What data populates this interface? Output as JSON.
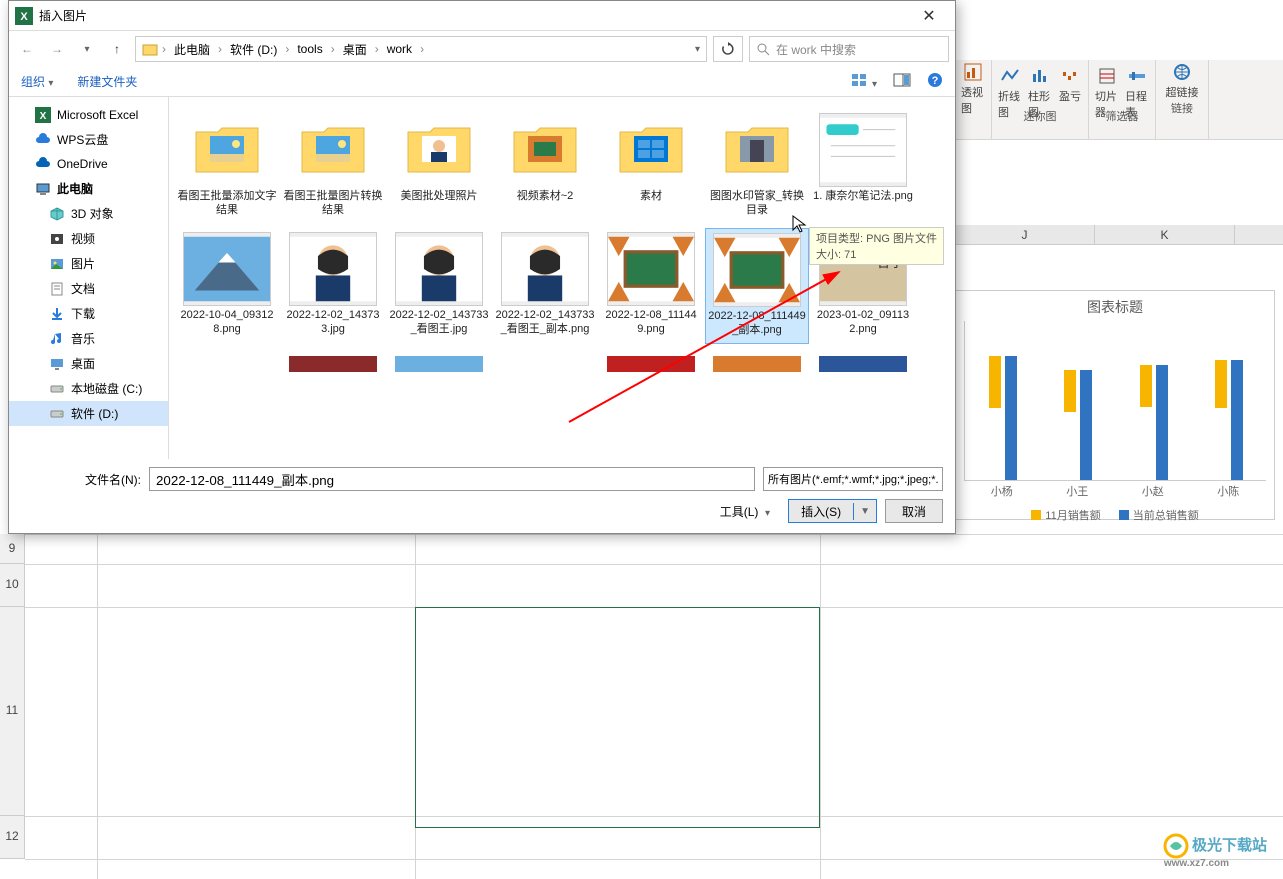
{
  "dialog": {
    "title": "插入图片",
    "close": "✕",
    "breadcrumbs": [
      "此电脑",
      "软件 (D:)",
      "tools",
      "桌面",
      "work"
    ],
    "search_placeholder": "在 work 中搜索",
    "organize": "组织",
    "new_folder": "新建文件夹",
    "filename_label": "文件名(N):",
    "filename_value": "2022-12-08_111449_副本.png",
    "filetype": "所有图片(*.emf;*.wmf;*.jpg;*.jpeg;*.png;*.gif;*.bmp)",
    "tools": "工具(L)",
    "insert": "插入(S)",
    "cancel": "取消",
    "tooltip_type": "项目类型: PNG 图片文件",
    "tooltip_size": "大小: 71"
  },
  "nav_tree": [
    {
      "label": "Microsoft Excel",
      "icon": "excel"
    },
    {
      "label": "WPS云盘",
      "icon": "cloud-blue"
    },
    {
      "label": "OneDrive",
      "icon": "onedrive"
    },
    {
      "label": "此电脑",
      "icon": "pc",
      "bold": true
    },
    {
      "label": "3D 对象",
      "icon": "cube",
      "indent": true
    },
    {
      "label": "视频",
      "icon": "video",
      "indent": true
    },
    {
      "label": "图片",
      "icon": "image",
      "indent": true
    },
    {
      "label": "文档",
      "icon": "doc",
      "indent": true
    },
    {
      "label": "下载",
      "icon": "download",
      "indent": true
    },
    {
      "label": "音乐",
      "icon": "music",
      "indent": true
    },
    {
      "label": "桌面",
      "icon": "desktop",
      "indent": true
    },
    {
      "label": "本地磁盘 (C:)",
      "icon": "disk",
      "indent": true
    },
    {
      "label": "软件 (D:)",
      "icon": "disk",
      "indent": true,
      "selected": true
    }
  ],
  "files_row1": [
    {
      "name": "看图王批量添加文字结果",
      "type": "folder",
      "preview": "beach"
    },
    {
      "name": "看图王批量图片转换结果",
      "type": "folder",
      "preview": "beach"
    },
    {
      "name": "美图批处理照片",
      "type": "folder",
      "preview": "portrait1"
    },
    {
      "name": "视频素材~2",
      "type": "folder",
      "preview": "autumn"
    },
    {
      "name": "素材",
      "type": "folder",
      "preview": "win"
    },
    {
      "name": "图图水印管家_转换目录",
      "type": "folder",
      "preview": "building"
    },
    {
      "name": "1. 康奈尔笔记法.png",
      "type": "png",
      "preview": "notes"
    }
  ],
  "files_row2": [
    {
      "name": "2022-10-04_093128.png",
      "type": "png",
      "preview": "fuji"
    },
    {
      "name": "2022-12-02_143733.jpg",
      "type": "jpg",
      "preview": "portrait2"
    },
    {
      "name": "2022-12-02_143733_看图王.jpg",
      "type": "jpg",
      "preview": "portrait3"
    },
    {
      "name": "2022-12-02_143733_看图王_副本.png",
      "type": "png",
      "preview": "portrait4"
    },
    {
      "name": "2022-12-08_111449.png",
      "type": "png",
      "preview": "board1"
    },
    {
      "name": "2022-12-08_111449_副本.png",
      "type": "png",
      "preview": "board2",
      "selected": true
    },
    {
      "name": "2023-01-02_091132.png",
      "type": "png",
      "preview": "card"
    }
  ],
  "ribbon": {
    "group1_label": "透视图",
    "sparkline_label": "迷你图",
    "spark_items": [
      "折线图",
      "柱形图",
      "盈亏"
    ],
    "filter_label": "筛选器",
    "filter_items": [
      "切片器",
      "日程表"
    ],
    "link_label": "链接",
    "link_item": "超链接"
  },
  "chart_data": {
    "type": "bar",
    "title": "图表标题",
    "categories": [
      "小杨",
      "小王",
      "小赵",
      "小陈"
    ],
    "series": [
      {
        "name": "11月销售额",
        "values": [
          55,
          45,
          45,
          50
        ]
      },
      {
        "name": "当前总销售额",
        "values": [
          130,
          115,
          120,
          125
        ]
      }
    ],
    "ylim": [
      0,
      140
    ]
  },
  "sheet": {
    "cols": [
      "J",
      "K"
    ],
    "rows": [
      "9",
      "10",
      "11",
      "12"
    ]
  },
  "watermark": {
    "name": "极光下载站",
    "url": "www.xz7.com"
  }
}
